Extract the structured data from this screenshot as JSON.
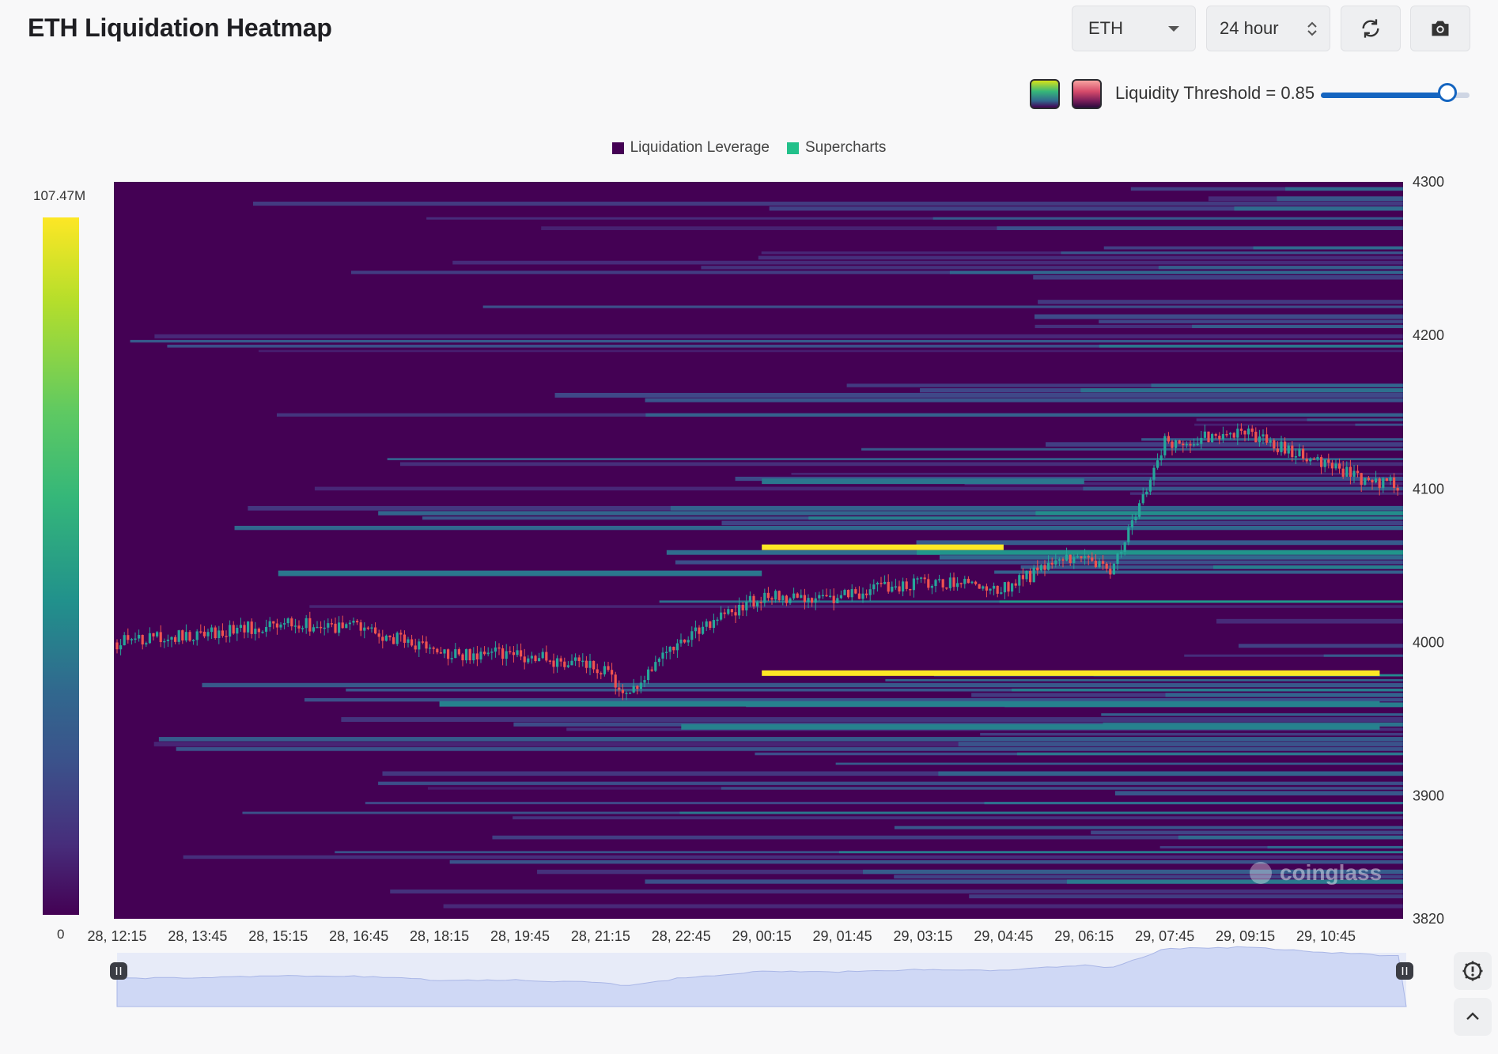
{
  "title": "ETH Liquidation Heatmap",
  "controls": {
    "symbol": "ETH",
    "range": "24 hour",
    "threshold_label": "Liquidity Threshold = 0.85",
    "threshold_value": 0.85
  },
  "icons": {
    "refresh": "refresh-icon",
    "camera": "camera-icon",
    "settings": "settings-icon",
    "collapse": "chevron-up-icon"
  },
  "colors": {
    "accent": "#1565c0",
    "background": "#440154",
    "bullish": "#26a69a",
    "bearish": "#ef5350",
    "highlight": "#fde725"
  },
  "legend": [
    {
      "label": "Liquidation Leverage",
      "color": "#440154"
    },
    {
      "label": "Supercharts",
      "color": "#22c08a"
    }
  ],
  "colorscale": {
    "max_label": "107.47M",
    "min_label": "0"
  },
  "watermark": "coinglass",
  "chart_data": {
    "type": "heatmap",
    "title": "ETH Liquidation Heatmap",
    "y_range": [
      3820,
      4300
    ],
    "y_ticks": [
      4300,
      4200,
      4100,
      4000,
      3900,
      3820
    ],
    "x_ticks": [
      "28, 12:15",
      "28, 13:45",
      "28, 15:15",
      "28, 16:45",
      "28, 18:15",
      "28, 19:45",
      "28, 21:15",
      "28, 22:45",
      "29, 00:15",
      "29, 01:45",
      "29, 03:15",
      "29, 04:45",
      "29, 06:15",
      "29, 07:45",
      "29, 09:15",
      "29, 10:45"
    ],
    "colorscale_range": [
      0,
      107.47
    ],
    "colorscale_unit": "M",
    "price_series": {
      "x": [
        "28, 12:15",
        "28, 13:45",
        "28, 15:15",
        "28, 16:45",
        "28, 18:15",
        "28, 19:45",
        "28, 21:15",
        "28, 21:45",
        "28, 22:45",
        "29, 00:15",
        "29, 01:45",
        "29, 03:15",
        "29, 04:45",
        "29, 06:15",
        "29, 06:45",
        "29, 07:45",
        "29, 09:15",
        "29, 10:45",
        "29, 11:45"
      ],
      "y": [
        4000,
        4005,
        4012,
        4010,
        3993,
        3992,
        3983,
        3965,
        4003,
        4030,
        4030,
        4040,
        4035,
        4060,
        4043,
        4130,
        4137,
        4115,
        4103
      ]
    },
    "liquidation_bands": [
      {
        "price": 4062,
        "from": "29, 00:15",
        "to": "29, 04:45",
        "intensity": 1.0
      },
      {
        "price": 3980,
        "from": "29, 00:15",
        "to": "29, 11:45",
        "intensity": 1.0
      },
      {
        "price": 4105,
        "from": "29, 00:15",
        "to": "29, 06:15",
        "intensity": 0.45
      },
      {
        "price": 3960,
        "from": "28, 18:15",
        "to": "29, 11:45",
        "intensity": 0.5
      },
      {
        "price": 3945,
        "from": "28, 22:45",
        "to": "29, 11:45",
        "intensity": 0.5
      },
      {
        "price": 4045,
        "from": "28, 15:15",
        "to": "29, 00:15",
        "intensity": 0.45
      }
    ]
  }
}
